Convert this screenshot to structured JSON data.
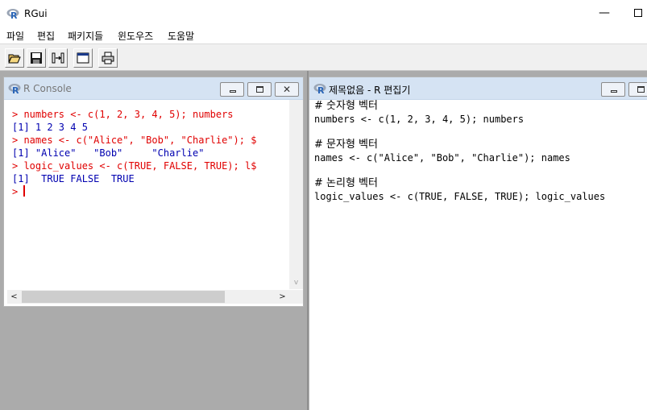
{
  "window": {
    "title": "RGui"
  },
  "menu": {
    "items": [
      "파일",
      "편집",
      "패키지들",
      "윈도우즈",
      "도움말"
    ]
  },
  "window_controls": {
    "minimize": "—"
  },
  "toolbar": {
    "buttons": [
      {
        "icon": "open-folder-icon"
      },
      {
        "icon": "save-icon"
      },
      {
        "icon": "load-workspace-icon"
      },
      {
        "icon": "console-window-icon"
      },
      {
        "icon": "print-icon"
      }
    ]
  },
  "console": {
    "title": "R Console",
    "lines": [
      {
        "kind": "cmd",
        "text": "> numbers <- c(1, 2, 3, 4, 5); numbers"
      },
      {
        "kind": "out",
        "text": "[1] 1 2 3 4 5"
      },
      {
        "kind": "cmd",
        "text": "> names <- c(\"Alice\", \"Bob\", \"Charlie\"); $"
      },
      {
        "kind": "out",
        "text": "[1] \"Alice\"   \"Bob\"     \"Charlie\""
      },
      {
        "kind": "cmd",
        "text": "> logic_values <- c(TRUE, FALSE, TRUE); l$"
      },
      {
        "kind": "out",
        "text": "[1]  TRUE FALSE  TRUE"
      },
      {
        "kind": "prompt",
        "text": "> "
      }
    ],
    "scroll_left": "<",
    "scroll_right": ">",
    "scroll_down": "v"
  },
  "editor": {
    "title": "제목없음 - R 편집기",
    "lines": [
      {
        "kind": "comment",
        "text": "# 숫자형 벡터"
      },
      {
        "kind": "code",
        "text": "numbers <- c(1, 2, 3, 4, 5); numbers"
      },
      {
        "kind": "blank",
        "text": ""
      },
      {
        "kind": "comment",
        "text": "# 문자형 벡터"
      },
      {
        "kind": "code",
        "text": "names <- c(\"Alice\", \"Bob\", \"Charlie\"); names"
      },
      {
        "kind": "blank",
        "text": ""
      },
      {
        "kind": "comment",
        "text": "# 논리형 벡터"
      },
      {
        "kind": "code",
        "text": "logic_values <- c(TRUE, FALSE, TRUE); logic_values"
      }
    ]
  },
  "colors": {
    "console_command": "#e00000",
    "console_output": "#0000b0",
    "caption_bg": "#d5e3f3",
    "workspace_bg": "#ababab"
  }
}
